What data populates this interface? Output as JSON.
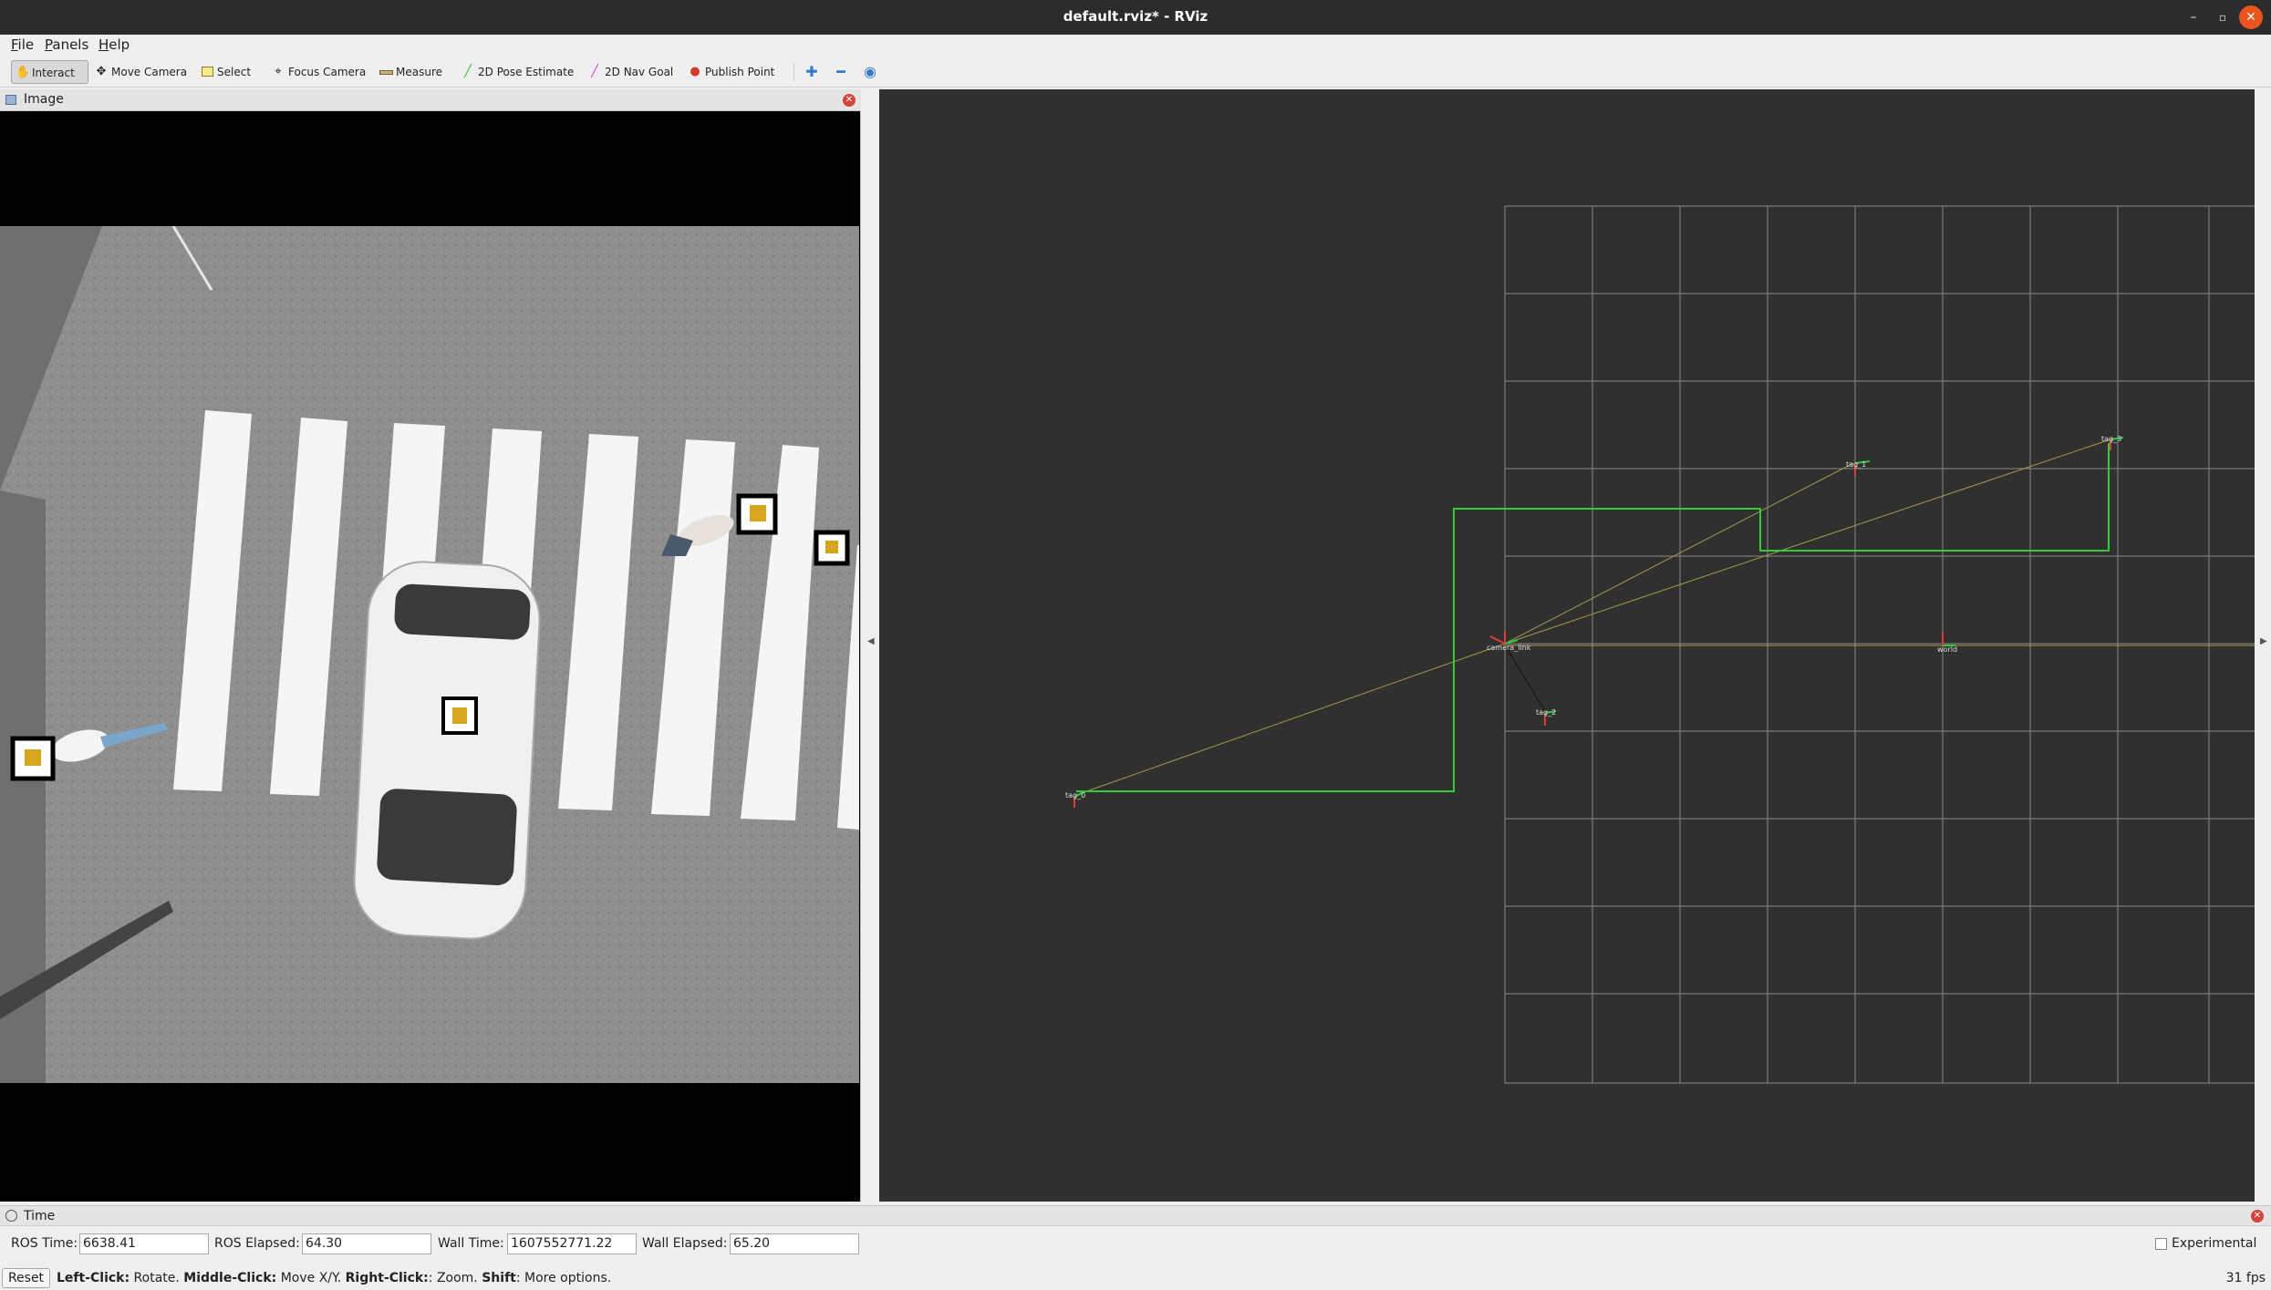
{
  "window": {
    "title": "default.rviz* - RViz",
    "minimize": "–",
    "maximize": "▫",
    "close": "✕"
  },
  "menu": [
    {
      "label": "File",
      "mnemonic": "F",
      "rest": "ile"
    },
    {
      "label": "Panels",
      "mnemonic": "P",
      "rest": "anels"
    },
    {
      "label": "Help",
      "mnemonic": "H",
      "rest": "elp"
    }
  ],
  "toolbar": {
    "interact": "Interact",
    "move_camera": "Move Camera",
    "select": "Select",
    "focus_camera": "Focus Camera",
    "measure": "Measure",
    "pose_estimate": "2D Pose Estimate",
    "nav_goal": "2D Nav Goal",
    "publish_point": "Publish Point"
  },
  "image_panel": {
    "title": "Image"
  },
  "time_panel": {
    "title": "Time",
    "ros_time_label": "ROS Time:",
    "ros_time": "6638.41",
    "ros_elapsed_label": "ROS Elapsed:",
    "ros_elapsed": "64.30",
    "wall_time_label": "Wall Time:",
    "wall_time": "1607552771.22",
    "wall_elapsed_label": "Wall Elapsed:",
    "wall_elapsed": "65.20",
    "experimental_label": "Experimental",
    "experimental_checked": false
  },
  "status": {
    "reset": "Reset",
    "left_click": "Left-Click:",
    "left_click_desc": " Rotate. ",
    "middle_click": "Middle-Click:",
    "middle_click_desc": " Move X/Y. ",
    "right_click": "Right-Click:",
    "right_click_desc": ": Zoom. ",
    "shift": "Shift",
    "shift_desc": ": More options.",
    "fps": "31 fps"
  },
  "view3d": {
    "frames": [
      {
        "name": "tag_0",
        "label": "tag_0"
      },
      {
        "name": "tag_1",
        "label": "tag_1"
      },
      {
        "name": "tag_2",
        "label": "tag_2"
      },
      {
        "name": "tag_3",
        "label": "tag_3"
      },
      {
        "name": "camera",
        "label": "camera_link"
      },
      {
        "name": "world",
        "label": "world"
      }
    ],
    "colors": {
      "background": "#303030",
      "grid": "#8a8a8a",
      "path": "#33cc33",
      "tf_line": "#a39a4c"
    }
  }
}
